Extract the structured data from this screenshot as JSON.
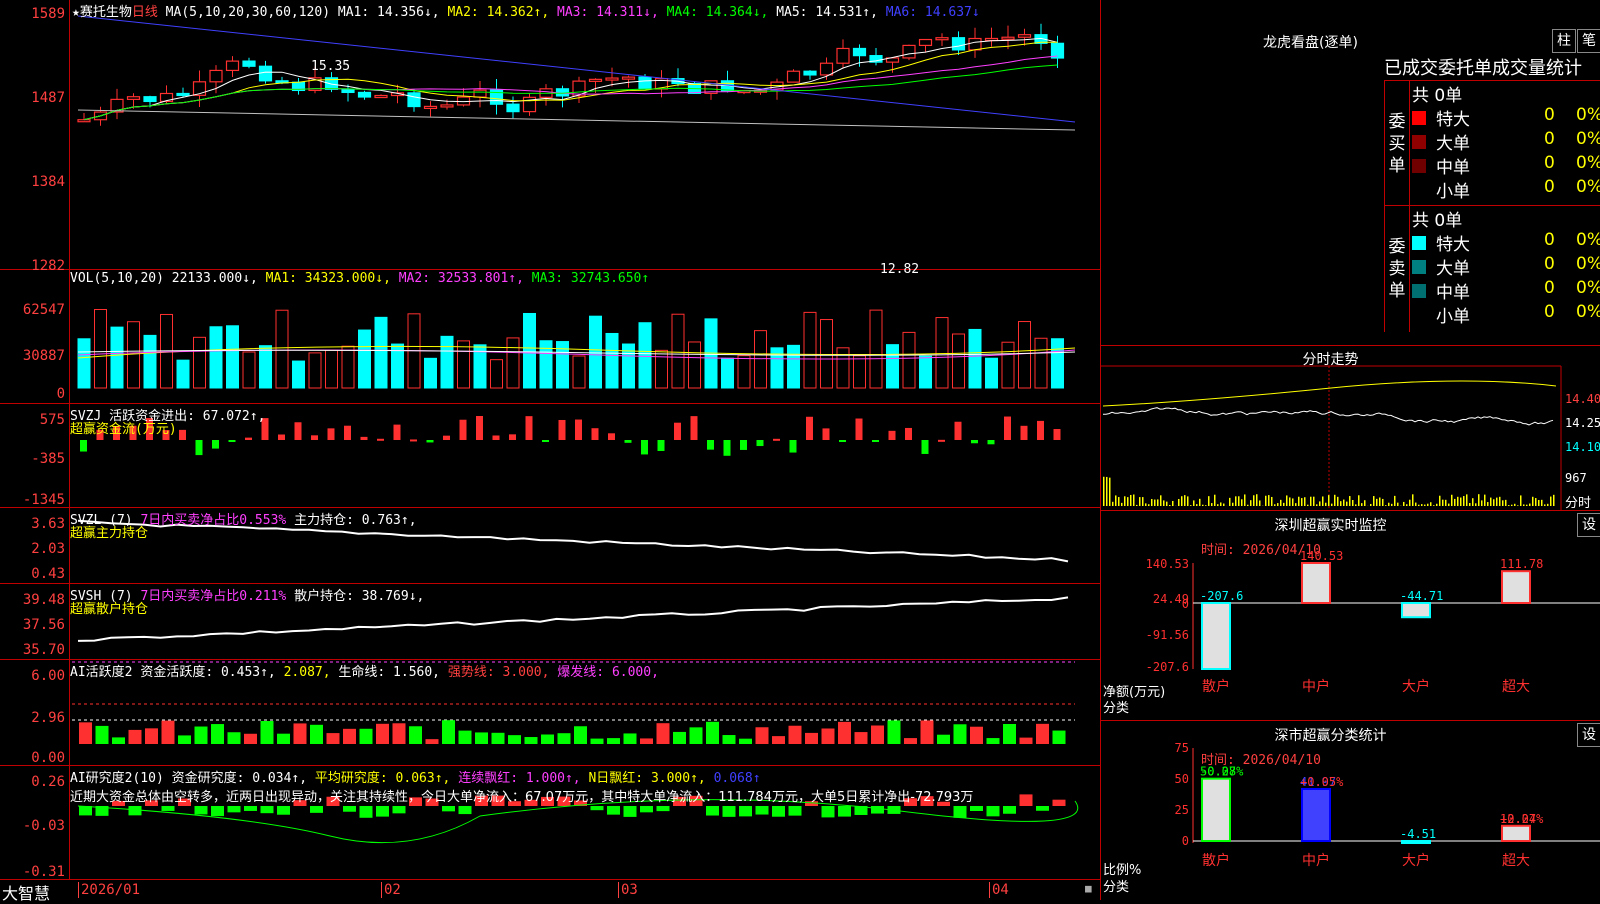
{
  "stock": {
    "name": "★赛托生物",
    "period": "日线",
    "app_logo": "大智慧"
  },
  "colors": {
    "up": "#ff3030",
    "down": "#00ffff",
    "axis": "#ff4040",
    "border": "#c00000",
    "ma_white": "#ffffff",
    "ma_yellow": "#ffff00",
    "ma_magenta": "#ff40ff",
    "ma_green": "#00ff00",
    "ma_blue": "#4040ff",
    "ma_gray": "#c0c0c0"
  },
  "price_panel": {
    "ma_params": "MA(5,10,20,30,60,120)",
    "ma1": "MA1: 14.356↓,",
    "ma2": "MA2: 14.362↑,",
    "ma3": "MA3: 14.311↓,",
    "ma4": "MA4: 14.364↓,",
    "ma5": "MA5: 14.531↑,",
    "ma6": "MA6: 14.637↓",
    "y_labels": [
      "1589",
      "1487",
      "1384",
      "1282"
    ],
    "high_label": "15.35",
    "low_label": "12.82"
  },
  "vol_panel": {
    "title": "VOL(5,10,20)",
    "cur": "22133.000↓,",
    "ma1": "MA1: 34323.000↓,",
    "ma2": "MA2: 32533.801↑,",
    "ma3": "MA3: 32743.650↑",
    "y_labels": [
      "62547",
      "30887",
      "0"
    ]
  },
  "svzj_panel": {
    "title": "SVZJ",
    "label": "活跃资金进出: 67.072↑,",
    "sub": "超赢资金流(万元)",
    "y_labels": [
      "575",
      "-385",
      "-1345"
    ]
  },
  "svzl_panel": {
    "title": "SVZL (7)",
    "ratio": "7日内买卖净占比0.553%",
    "hold": "主力持仓: 0.763↑,",
    "sub": "超赢主力持仓",
    "y_labels": [
      "3.63",
      "2.03",
      "0.43"
    ]
  },
  "svsh_panel": {
    "title": "SVSH (7)",
    "ratio": "7日内买卖净占比0.211%",
    "hold": "散户持仓: 38.769↓,",
    "sub": "超赢散户持仓",
    "y_labels": [
      "39.48",
      "37.56",
      "35.70"
    ]
  },
  "ai_active_panel": {
    "title": "AI活跃度2",
    "a": "资金活跃度: 0.453↑,",
    "b": "2.087,",
    "c": "生命线: 1.560,",
    "d": "强势线: 3.000,",
    "e": "爆发线: 6.000,",
    "y_labels": [
      "6.00",
      "2.96",
      "0.00"
    ]
  },
  "ai_research_panel": {
    "title": "AI研究度2(10)",
    "a": "资金研究度: 0.034↑,",
    "b": "平均研究度: 0.063↑,",
    "c": "连续飘红: 1.000↑,",
    "d": "N日飘红: 3.000↑,",
    "e": "0.068↑",
    "comment": "近期大资金总体由空转多，近两日出现异动，关注其持续性，今日大单净流入：67.07万元，其中特大单净流入：111.784万元，大单5日累计净出-72.793万",
    "y_labels": [
      "0.26",
      "-0.03",
      "-0.31"
    ]
  },
  "x_axis": {
    "labels": [
      "2026/01",
      "02",
      "03",
      "04"
    ]
  },
  "dragon": {
    "title": "龙虎看盘(逐单)",
    "btn1": "柱",
    "btn2": "笔",
    "tabs": "已成交委托单成交量统计",
    "buy_label": "委买单",
    "sell_label": "委卖单",
    "buy_total": "共 0单",
    "sell_total": "共 0单",
    "buy_rows": [
      {
        "name": "特大",
        "count": "0",
        "pct": "0%",
        "color": "#ff0000"
      },
      {
        "name": "大单",
        "count": "0",
        "pct": "0%",
        "color": "#900000"
      },
      {
        "name": "中单",
        "count": "0",
        "pct": "0%",
        "color": "#700000"
      },
      {
        "name": "小单",
        "count": "0",
        "pct": "0%",
        "color": "#000000"
      }
    ],
    "sell_rows": [
      {
        "name": "特大",
        "count": "0",
        "pct": "0%",
        "color": "#00ffff"
      },
      {
        "name": "大单",
        "count": "0",
        "pct": "0%",
        "color": "#008080"
      },
      {
        "name": "中单",
        "count": "0",
        "pct": "0%",
        "color": "#007070"
      },
      {
        "name": "小单",
        "count": "0",
        "pct": "0%",
        "color": "#000000"
      }
    ]
  },
  "intraday": {
    "title": "分时走势",
    "p1": "14.40",
    "p2": "14.25",
    "p3": "14.10",
    "vol": "967",
    "unit": "分时"
  },
  "sz_monitor": {
    "title": "深圳超赢实时监控",
    "btn": "设",
    "time": "时间: 2026/04/10",
    "y_labels": [
      "140.53",
      "24.49",
      "0",
      "-91.56",
      "-207.6"
    ],
    "unit": "净额(万元)",
    "cat_label": "分类",
    "bars": [
      {
        "cat": "散户",
        "value": -207.6,
        "label": "-207.6"
      },
      {
        "cat": "中户",
        "value": 140.53,
        "label": "140.53"
      },
      {
        "cat": "大户",
        "value": -44.71,
        "label": "-44.71"
      },
      {
        "cat": "超大",
        "value": 111.78,
        "label": "111.78"
      }
    ]
  },
  "sz_class": {
    "title": "深市超赢分类统计",
    "btn": "设",
    "time": "时间: 2026/04/10",
    "y_labels": [
      "75",
      "50",
      "25",
      "0"
    ],
    "unit": "比例%",
    "cat_label": "分类",
    "bars": [
      {
        "cat": "散户",
        "value": 50.27,
        "label": "50.27",
        "chg": "-0.08%"
      },
      {
        "cat": "中户",
        "value": 41.97,
        "label": "41.97",
        "chg": "+0.05%"
      },
      {
        "cat": "大户",
        "value": -4.51,
        "label": "-4.51",
        "chg": ""
      },
      {
        "cat": "超大",
        "value": 12.27,
        "label": "12.27",
        "chg": "+0.04%"
      }
    ]
  }
}
